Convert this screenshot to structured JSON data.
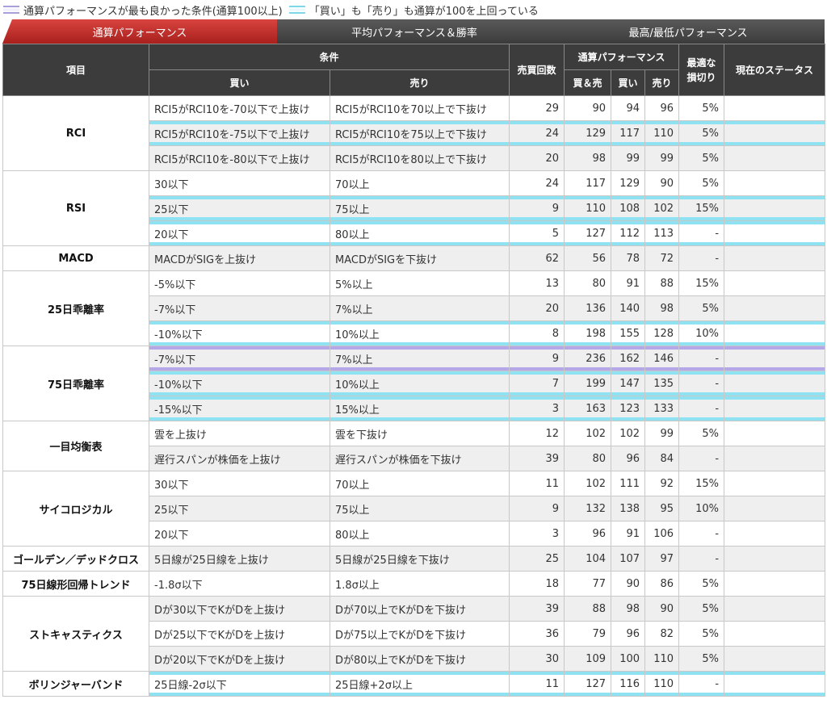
{
  "legend": {
    "item1": "通算パフォーマンスが最も良かった条件(通算100以上)",
    "item2": "「買い」も「売り」も通算が100を上回っている"
  },
  "tabs": [
    "通算パフォーマンス",
    "平均パフォーマンス＆勝率",
    "最高/最低パフォーマンス"
  ],
  "header": {
    "item": "項目",
    "condition": "条件",
    "buy": "買い",
    "sell": "売り",
    "trades": "売買回数",
    "performance": "通算パフォーマンス",
    "both": "買＆売",
    "perf_buy": "買い",
    "perf_sell": "売り",
    "stoploss": "最適な損切り",
    "status": "現在のステータス"
  },
  "groups": [
    {
      "name": "RCI",
      "rows": [
        {
          "buy": "RCI5がRCI10を-70以下で上抜け",
          "sell": "RCI5がRCI10を70以上で下抜け",
          "count": "29",
          "total": "90",
          "b": "94",
          "s": "96",
          "loss": "5%",
          "hl": "none",
          "alt": false
        },
        {
          "buy": "RCI5がRCI10を-75以下で上抜け",
          "sell": "RCI5がRCI10を75以上で下抜け",
          "count": "24",
          "total": "129",
          "b": "117",
          "s": "110",
          "loss": "5%",
          "hl": "cyan",
          "alt": true
        },
        {
          "buy": "RCI5がRCI10を-80以下で上抜け",
          "sell": "RCI5がRCI10を80以上で下抜け",
          "count": "20",
          "total": "98",
          "b": "99",
          "s": "99",
          "loss": "5%",
          "hl": "none",
          "alt": true
        }
      ]
    },
    {
      "name": "RSI",
      "rows": [
        {
          "buy": "30以下",
          "sell": "70以上",
          "count": "24",
          "total": "117",
          "b": "129",
          "s": "90",
          "loss": "5%",
          "hl": "none",
          "alt": false
        },
        {
          "buy": "25以下",
          "sell": "75以上",
          "count": "9",
          "total": "110",
          "b": "108",
          "s": "102",
          "loss": "15%",
          "hl": "cyan",
          "alt": true
        },
        {
          "buy": "20以下",
          "sell": "80以上",
          "count": "5",
          "total": "127",
          "b": "112",
          "s": "113",
          "loss": "-",
          "hl": "cyan",
          "alt": false
        }
      ]
    },
    {
      "name": "MACD",
      "rows": [
        {
          "buy": "MACDがSIGを上抜け",
          "sell": "MACDがSIGを下抜け",
          "count": "62",
          "total": "56",
          "b": "78",
          "s": "72",
          "loss": "-",
          "hl": "none",
          "alt": true
        }
      ]
    },
    {
      "name": "25日乖離率",
      "rows": [
        {
          "buy": "-5%以下",
          "sell": "5%以上",
          "count": "13",
          "total": "80",
          "b": "91",
          "s": "88",
          "loss": "15%",
          "hl": "none",
          "alt": false
        },
        {
          "buy": "-7%以下",
          "sell": "7%以上",
          "count": "20",
          "total": "136",
          "b": "140",
          "s": "98",
          "loss": "5%",
          "hl": "none",
          "alt": true
        },
        {
          "buy": "-10%以下",
          "sell": "10%以上",
          "count": "8",
          "total": "198",
          "b": "155",
          "s": "128",
          "loss": "10%",
          "hl": "cyan",
          "alt": false
        }
      ]
    },
    {
      "name": "75日乖離率",
      "rows": [
        {
          "buy": "-7%以下",
          "sell": "7%以上",
          "count": "9",
          "total": "236",
          "b": "162",
          "s": "146",
          "loss": "-",
          "hl": "purple",
          "alt": true
        },
        {
          "buy": "-10%以下",
          "sell": "10%以上",
          "count": "7",
          "total": "199",
          "b": "147",
          "s": "135",
          "loss": "-",
          "hl": "cyan",
          "alt": true
        },
        {
          "buy": "-15%以下",
          "sell": "15%以上",
          "count": "3",
          "total": "163",
          "b": "123",
          "s": "133",
          "loss": "-",
          "hl": "cyan",
          "alt": true
        }
      ]
    },
    {
      "name": "一目均衡表",
      "rows": [
        {
          "buy": "雲を上抜け",
          "sell": "雲を下抜け",
          "count": "12",
          "total": "102",
          "b": "102",
          "s": "99",
          "loss": "5%",
          "hl": "none",
          "alt": false
        },
        {
          "buy": "遅行スパンが株価を上抜け",
          "sell": "遅行スパンが株価を下抜け",
          "count": "39",
          "total": "80",
          "b": "96",
          "s": "84",
          "loss": "-",
          "hl": "none",
          "alt": true
        }
      ]
    },
    {
      "name": "サイコロジカル",
      "rows": [
        {
          "buy": "30以下",
          "sell": "70以上",
          "count": "11",
          "total": "102",
          "b": "111",
          "s": "92",
          "loss": "15%",
          "hl": "none",
          "alt": false
        },
        {
          "buy": "25以下",
          "sell": "75以上",
          "count": "9",
          "total": "132",
          "b": "138",
          "s": "95",
          "loss": "10%",
          "hl": "none",
          "alt": true
        },
        {
          "buy": "20以下",
          "sell": "80以上",
          "count": "3",
          "total": "96",
          "b": "91",
          "s": "106",
          "loss": "-",
          "hl": "none",
          "alt": false
        }
      ]
    },
    {
      "name": "ゴールデン／デッドクロス",
      "rows": [
        {
          "buy": "5日線が25日線を上抜け",
          "sell": "5日線が25日線を下抜け",
          "count": "25",
          "total": "104",
          "b": "107",
          "s": "97",
          "loss": "-",
          "hl": "none",
          "alt": true
        }
      ]
    },
    {
      "name": "75日線形回帰トレンド",
      "rows": [
        {
          "buy": "-1.8σ以下",
          "sell": "1.8σ以上",
          "count": "18",
          "total": "77",
          "b": "90",
          "s": "86",
          "loss": "5%",
          "hl": "none",
          "alt": false
        }
      ]
    },
    {
      "name": "ストキャスティクス",
      "rows": [
        {
          "buy": "Dが30以下でKがDを上抜け",
          "sell": "Dが70以上でKがDを下抜け",
          "count": "39",
          "total": "88",
          "b": "98",
          "s": "90",
          "loss": "5%",
          "hl": "none",
          "alt": true
        },
        {
          "buy": "Dが25以下でKがDを上抜け",
          "sell": "Dが75以上でKがDを下抜け",
          "count": "36",
          "total": "79",
          "b": "96",
          "s": "82",
          "loss": "5%",
          "hl": "none",
          "alt": false
        },
        {
          "buy": "Dが20以下でKがDを上抜け",
          "sell": "Dが80以上でKがDを下抜け",
          "count": "30",
          "total": "109",
          "b": "100",
          "s": "110",
          "loss": "5%",
          "hl": "none",
          "alt": true
        }
      ]
    },
    {
      "name": "ボリンジャーバンド",
      "rows": [
        {
          "buy": "25日線-2σ以下",
          "sell": "25日線+2σ以上",
          "count": "11",
          "total": "127",
          "b": "116",
          "s": "110",
          "loss": "-",
          "hl": "cyan",
          "alt": false
        }
      ]
    }
  ],
  "colors": {
    "tab_active": "#c9302c",
    "tab_inactive": "#4a4a4a",
    "header_bg": "#3c3c3c",
    "highlight_cyan": "#8fe2f1",
    "highlight_purple": "#b5a7e8"
  }
}
